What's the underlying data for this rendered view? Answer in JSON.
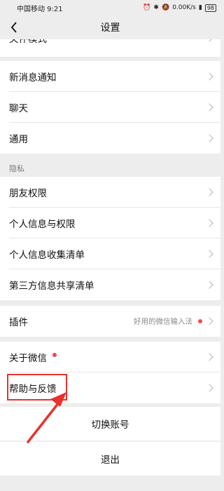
{
  "status_bar": {
    "carrier_time": "中国移动 9:21",
    "speed": "0.00K/s",
    "battery": "98"
  },
  "nav": {
    "title": "设置"
  },
  "rows": {
    "care_mode": "关怀模式",
    "new_message": "新消息通知",
    "chat": "聊天",
    "general": "通用",
    "privacy_section": "隐私",
    "friend_permissions": "朋友权限",
    "personal_info_permissions": "个人信息与权限",
    "personal_info_collection": "个人信息收集清单",
    "third_party_sharing": "第三方信息共享清单",
    "plugins": "插件",
    "plugins_hint": "好用的微信输入法",
    "about_wechat": "关于微信",
    "help_feedback": "帮助与反馈",
    "switch_account": "切换账号",
    "logout": "退出"
  },
  "colors": {
    "background": "#ededed",
    "red_dot": "#f04b4b",
    "annotation_red": "#e8322c"
  }
}
